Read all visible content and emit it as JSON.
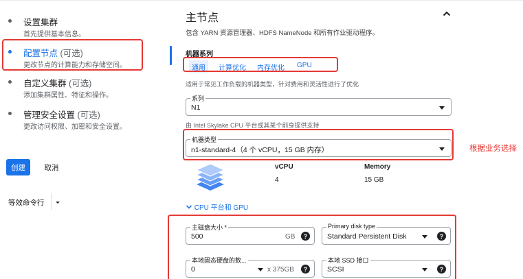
{
  "steps": [
    {
      "title": "设置集群",
      "optional": "",
      "sub": "首先提供基本信息。"
    },
    {
      "title": "配置节点",
      "optional": " (可选)",
      "sub": "更改节点的计算能力和存储空间。"
    },
    {
      "title": "自定义集群",
      "optional": " (可选)",
      "sub": "添加集群属性、特征和操作。"
    },
    {
      "title": "管理安全设置",
      "optional": " (可选)",
      "sub": "更改访问权限、加密和安全设置。"
    }
  ],
  "actions": {
    "create": "创建",
    "cancel": "取消",
    "equivalent": "等效命令行"
  },
  "section": {
    "title": "主节点",
    "description": "包含 YARN 资源管理器、HDFS NameNode 和所有作业驱动程序。",
    "machine_family_label": "机器系列",
    "tabs": [
      "通用",
      "计算优化",
      "内存优化",
      "GPU"
    ],
    "family_note": "适用于常见工作负载的机器类型，针对费用和灵活性进行了优化",
    "series": {
      "label": "系列",
      "value": "N1"
    },
    "series_note": "由 Intel Skylake CPU 平台或其某个前身提供支持",
    "machine_type": {
      "label": "机器类型",
      "value": "n1-standard-4（4 个 vCPU，15 GB 内存）"
    },
    "specs": {
      "vcpu_label": "vCPU",
      "vcpu": "4",
      "memory_label": "Memory",
      "memory": "15 GB"
    },
    "cpu_platform_link": "CPU 平台和 GPU",
    "disk_size": {
      "label": "主磁盘大小 *",
      "value": "500",
      "unit": "GB"
    },
    "disk_type": {
      "label": "Primary disk type",
      "value": "Standard Persistent Disk"
    },
    "local_ssd_count": {
      "label": "本地固态硬盘的数...",
      "value": "0",
      "unit": "x 375GB"
    },
    "ssd_interface": {
      "label": "本地 SSD 接口",
      "value": "SCSI"
    }
  },
  "annotation": "根据业务选择",
  "colors": {
    "accent": "#1a73e8",
    "highlight": "#e53935"
  }
}
